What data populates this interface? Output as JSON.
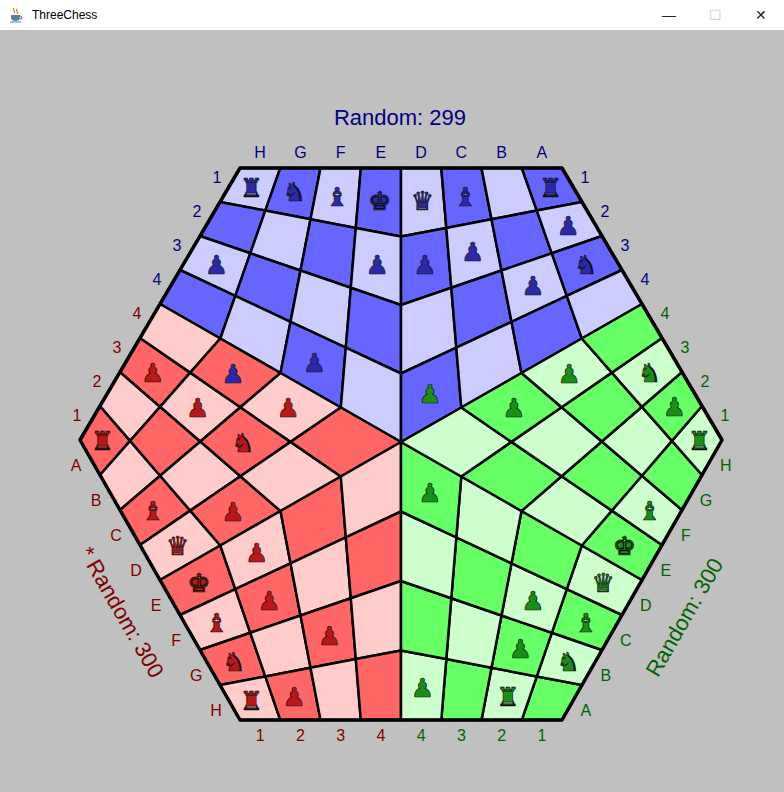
{
  "window": {
    "title": "ThreeChess",
    "controls": [
      {
        "glyph": "—",
        "disabled": false
      },
      {
        "glyph": "☐",
        "disabled": true
      },
      {
        "glyph": "✕",
        "disabled": false
      }
    ]
  },
  "players": [
    {
      "status": "Random: 299",
      "to_move": false,
      "color": "#000080",
      "light_square": "#ccccff",
      "dark_square": "#6666ff",
      "files": [
        "H",
        "G",
        "F",
        "E",
        "D",
        "C",
        "B",
        "A"
      ],
      "ranks": [
        "1",
        "2",
        "3",
        "4"
      ],
      "pieces": [
        {
          "glyph": "♜",
          "file": "H",
          "rank": "1",
          "color": "#2a2aa8"
        },
        {
          "glyph": "♞",
          "file": "G",
          "rank": "1",
          "color": "#2a2aa8"
        },
        {
          "glyph": "♝",
          "file": "F",
          "rank": "1",
          "color": "#2a2aa8"
        },
        {
          "glyph": "♚",
          "file": "E",
          "rank": "1",
          "color": "#2a2aa8"
        },
        {
          "glyph": "♛",
          "file": "D",
          "rank": "1",
          "color": "#2a2aa8"
        },
        {
          "glyph": "♝",
          "file": "C",
          "rank": "1",
          "color": "#2a2aa8"
        },
        {
          "glyph": "♜",
          "file": "A",
          "rank": "1",
          "color": "#2a2aa8"
        },
        {
          "glyph": "♟",
          "file": "A",
          "rank": "2",
          "color": "#2a2aa8"
        },
        {
          "glyph": "♞",
          "file": "A",
          "rank": "3",
          "color": "#2a2aa8"
        },
        {
          "glyph": "♟",
          "file": "H",
          "rank": "3",
          "color": "#2a2aa8"
        },
        {
          "glyph": "♟",
          "file": "E",
          "rank": "2",
          "color": "#2a2aa8"
        },
        {
          "glyph": "♟",
          "file": "D",
          "rank": "2",
          "color": "#2a2aa8"
        },
        {
          "glyph": "♟",
          "file": "C",
          "rank": "2",
          "color": "#2a2aa8"
        },
        {
          "glyph": "♟",
          "file": "B",
          "rank": "3",
          "color": "#2a2aa8"
        },
        {
          "glyph": "♟",
          "file": "F",
          "rank": "4",
          "color": "#2a2aa8"
        },
        {
          "glyph": "♟",
          "file": "D",
          "rank": "4",
          "color": "#189018"
        }
      ]
    },
    {
      "status": "Random: 300",
      "to_move": true,
      "marker": "*",
      "color": "#800000",
      "light_square": "#ffcccc",
      "dark_square": "#ff6666",
      "files": [
        "A",
        "B",
        "C",
        "D",
        "E",
        "F",
        "G",
        "H"
      ],
      "ranks": [
        "1",
        "2",
        "3",
        "4"
      ],
      "pieces": [
        {
          "glyph": "♜",
          "file": "A",
          "rank": "1",
          "color": "#b81818"
        },
        {
          "glyph": "♝",
          "file": "C",
          "rank": "1",
          "color": "#b81818"
        },
        {
          "glyph": "♛",
          "file": "D",
          "rank": "1",
          "color": "#b81818"
        },
        {
          "glyph": "♚",
          "file": "E",
          "rank": "1",
          "color": "#b81818"
        },
        {
          "glyph": "♝",
          "file": "F",
          "rank": "1",
          "color": "#b81818"
        },
        {
          "glyph": "♞",
          "file": "G",
          "rank": "1",
          "color": "#b81818"
        },
        {
          "glyph": "♜",
          "file": "H",
          "rank": "1",
          "color": "#b81818"
        },
        {
          "glyph": "♞",
          "file": "C",
          "rank": "3",
          "color": "#b81818"
        },
        {
          "glyph": "♟",
          "file": "A",
          "rank": "3",
          "color": "#b81818"
        },
        {
          "glyph": "♟",
          "file": "B",
          "rank": "3",
          "color": "#b81818"
        },
        {
          "glyph": "♟",
          "file": "C",
          "rank": "4",
          "color": "#b81818"
        },
        {
          "glyph": "♟",
          "file": "D",
          "rank": "2",
          "color": "#b81818"
        },
        {
          "glyph": "♟",
          "file": "E",
          "rank": "2",
          "color": "#b81818"
        },
        {
          "glyph": "♟",
          "file": "F",
          "rank": "2",
          "color": "#b81818"
        },
        {
          "glyph": "♟",
          "file": "G",
          "rank": "3",
          "color": "#b81818"
        },
        {
          "glyph": "♟",
          "file": "H",
          "rank": "2",
          "color": "#b81818"
        },
        {
          "glyph": "♟",
          "file": "B",
          "rank": "4",
          "color": "#2a2aa8"
        }
      ]
    },
    {
      "status": "Random: 300",
      "to_move": false,
      "color": "#006400",
      "light_square": "#ccffcc",
      "dark_square": "#66ff66",
      "files": [
        "A",
        "B",
        "C",
        "D",
        "E",
        "F",
        "G",
        "H"
      ],
      "ranks": [
        "1",
        "2",
        "3",
        "4"
      ],
      "pieces": [
        {
          "glyph": "♜",
          "file": "A",
          "rank": "2",
          "color": "#189018"
        },
        {
          "glyph": "♞",
          "file": "B",
          "rank": "1",
          "color": "#189018"
        },
        {
          "glyph": "♝",
          "file": "C",
          "rank": "1",
          "color": "#189018"
        },
        {
          "glyph": "♛",
          "file": "D",
          "rank": "1",
          "color": "#189018"
        },
        {
          "glyph": "♚",
          "file": "E",
          "rank": "1",
          "color": "#189018"
        },
        {
          "glyph": "♝",
          "file": "F",
          "rank": "1",
          "color": "#189018"
        },
        {
          "glyph": "♜",
          "file": "H",
          "rank": "1",
          "color": "#189018"
        },
        {
          "glyph": "♞",
          "file": "H",
          "rank": "3",
          "color": "#189018"
        },
        {
          "glyph": "♟",
          "file": "H",
          "rank": "2",
          "color": "#189018"
        },
        {
          "glyph": "♟",
          "file": "G",
          "rank": "4",
          "color": "#189018"
        },
        {
          "glyph": "♟",
          "file": "F",
          "rank": "4",
          "color": "#189018"
        },
        {
          "glyph": "♟",
          "file": "D",
          "rank": "4",
          "color": "#189018"
        },
        {
          "glyph": "♟",
          "file": "C",
          "rank": "2",
          "color": "#189018"
        },
        {
          "glyph": "♟",
          "file": "B",
          "rank": "2",
          "color": "#189018"
        },
        {
          "glyph": "♟",
          "file": "A",
          "rank": "4",
          "color": "#189018"
        }
      ]
    }
  ]
}
